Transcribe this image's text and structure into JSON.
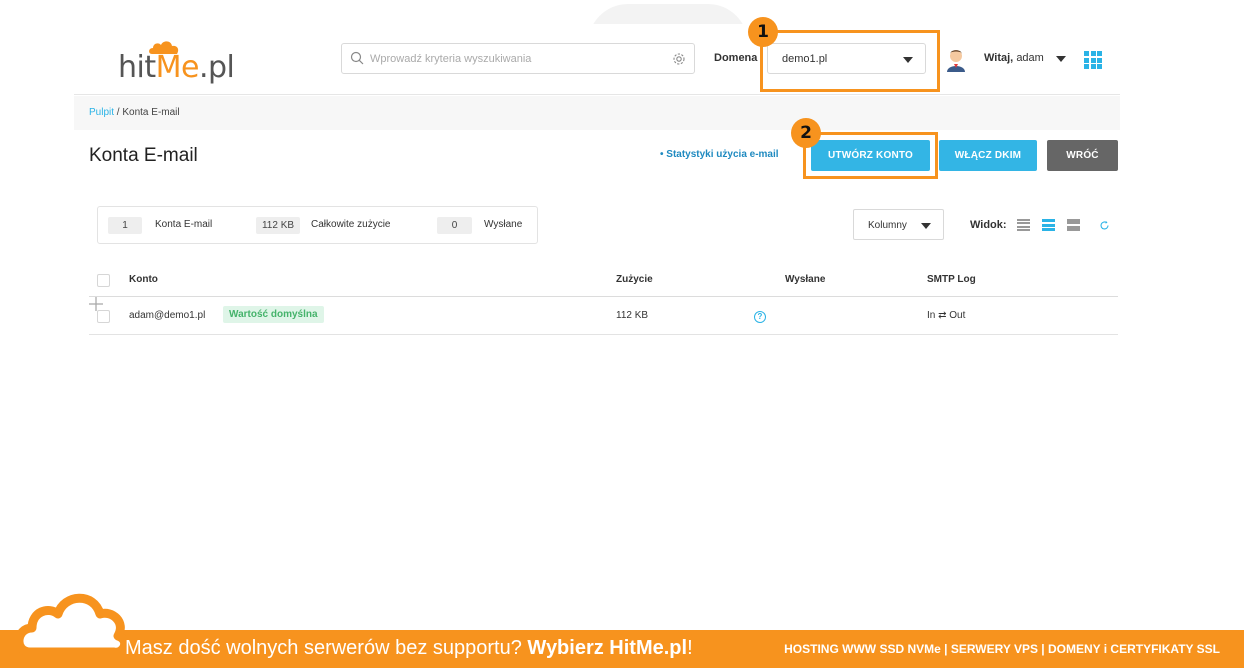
{
  "header": {
    "logo_prefix": "hit",
    "logo_accent": "Me",
    "logo_suffix": ".pl",
    "search_placeholder": "Wprowadź kryteria wyszukiwania",
    "domain_label": "Domena",
    "domain_value": "demo1.pl",
    "greeting_bold": "Witaj,",
    "greeting_user": "adam"
  },
  "annotations": {
    "marker1": "1",
    "marker2": "2"
  },
  "breadcrumb": {
    "home": "Pulpit",
    "separator": " / ",
    "current": "Konta E-mail"
  },
  "page": {
    "title": "Konta E-mail",
    "stats_link": "• Statystyki użycia e-mail",
    "create_button": "UTWÓRZ KONTO",
    "dkim_button": "WŁĄCZ DKIM",
    "back_button": "WRÓĆ"
  },
  "summary": {
    "accounts_count": "1",
    "accounts_label": "Konta E-mail",
    "usage_value": "112 KB",
    "usage_label": "Całkowite zużycie",
    "sent_count": "0",
    "sent_label": "Wysłane"
  },
  "toolbar": {
    "columns_label": "Kolumny",
    "view_label": "Widok:"
  },
  "table": {
    "headers": {
      "account": "Konto",
      "usage": "Zużycie",
      "sent": "Wysłane",
      "smtp": "SMTP Log"
    },
    "rows": [
      {
        "account": "adam@demo1.pl",
        "badge": "Wartość domyślna",
        "usage": "112 KB",
        "smtp": "In ⇄ Out"
      }
    ]
  },
  "footer": {
    "slogan_text": "Masz dość wolnych serwerów bez supportu?",
    "slogan_bold": "Wybierz HitMe.pl",
    "slogan_end": "!",
    "services": "HOSTING WWW SSD NVMe | SERWERY VPS | DOMENY i CERTYFIKATY SSL"
  },
  "colors": {
    "accent_orange": "#f7931e",
    "primary_blue": "#33b5e5",
    "dark_button": "#666666",
    "success_green": "#45b36b"
  }
}
